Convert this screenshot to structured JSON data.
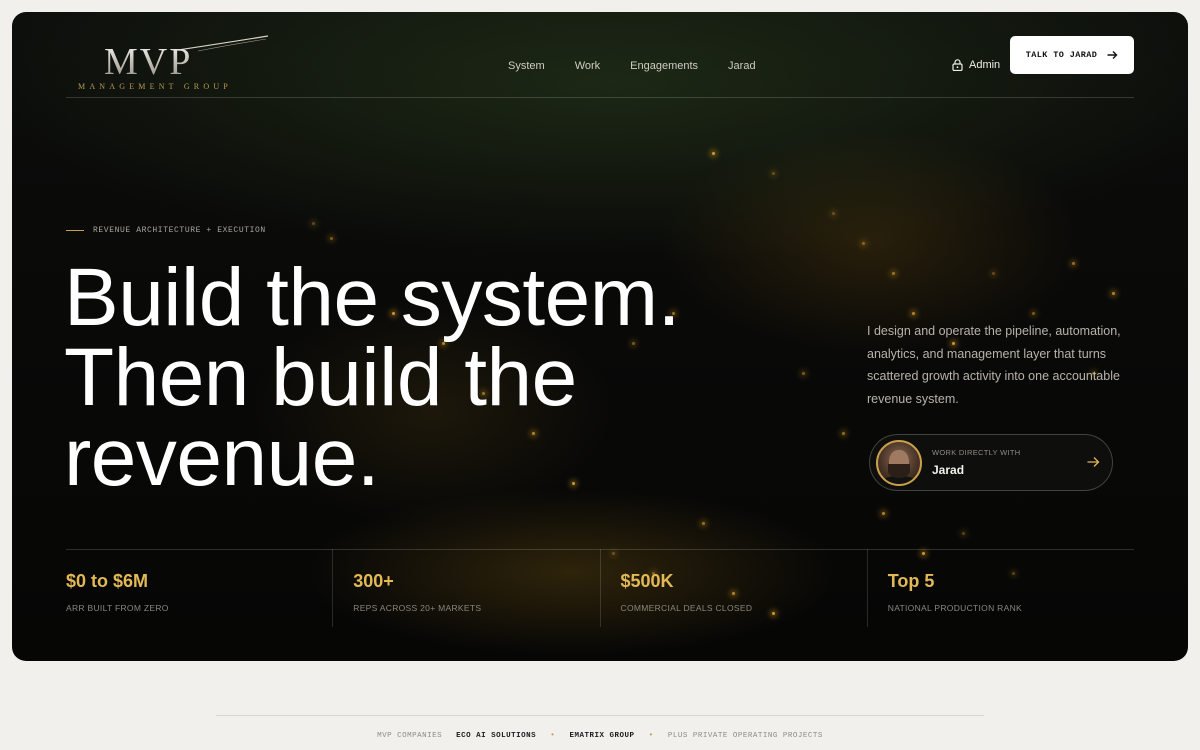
{
  "brand": {
    "logo_main": "MVP",
    "logo_sub": "MANAGEMENT GROUP"
  },
  "nav": {
    "items": [
      {
        "label": "System"
      },
      {
        "label": "Work"
      },
      {
        "label": "Engagements"
      },
      {
        "label": "Jarad"
      }
    ],
    "admin_label": "Admin",
    "admin_icon": "lock-icon",
    "cta_label": "TALK TO JARAD",
    "cta_icon": "arrow-right-icon"
  },
  "hero": {
    "eyebrow": "REVENUE ARCHITECTURE + EXECUTION",
    "headline_lines": [
      "Build the system.",
      "Then build the",
      "revenue."
    ],
    "description": "I design and operate the pipeline, automation, analytics, and management layer that turns scattered growth activity into one accountable revenue system.",
    "work_card": {
      "label": "WORK DIRECTLY WITH",
      "name": "Jarad",
      "icon": "arrow-right-icon"
    }
  },
  "stats": [
    {
      "value": "$0 to $6M",
      "label": "ARR BUILT FROM ZERO"
    },
    {
      "value": "300+",
      "label": "REPS ACROSS 20+ MARKETS"
    },
    {
      "value": "$500K",
      "label": "COMMERCIAL DEALS CLOSED"
    },
    {
      "value": "Top 5",
      "label": "NATIONAL PRODUCTION RANK"
    }
  ],
  "footer": {
    "lead": "MVP COMPANIES",
    "company_1": "ECO AI SOLUTIONS",
    "company_2": "EMATRIX GROUP",
    "tail": "PLUS PRIVATE OPERATING PROJECTS"
  },
  "colors": {
    "accent": "#e3b956",
    "hero_bg": "#0a0a09",
    "page_bg": "#f1f0ec"
  }
}
